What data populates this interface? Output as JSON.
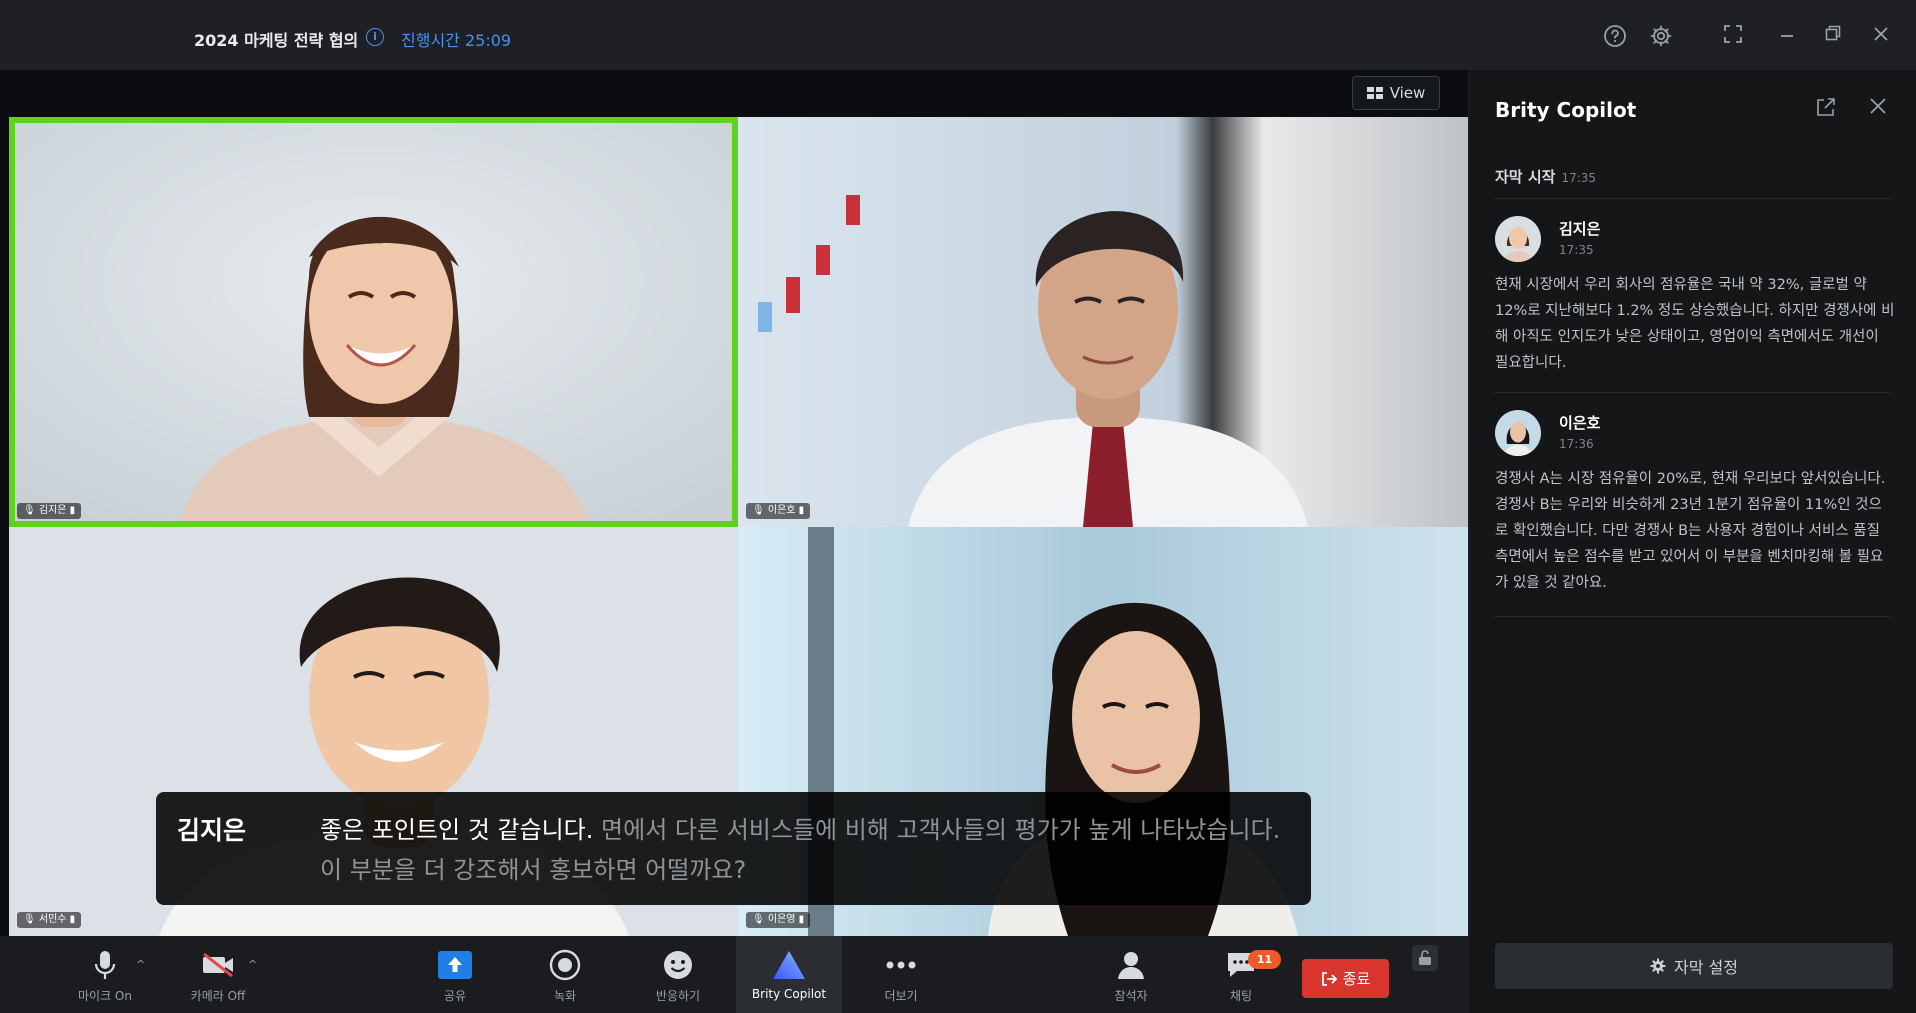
{
  "header": {
    "meeting_title": "2024 마케팅 전략 협의",
    "info_glyph": "i",
    "elapsed_label": "진행시간 25:09",
    "icons": [
      "help-icon",
      "settings-icon",
      "fullscreen-icon",
      "minimize-icon",
      "restore-icon",
      "close-icon"
    ]
  },
  "stage": {
    "view_label": "View",
    "participants": [
      {
        "tag": "김지은",
        "active": true
      },
      {
        "tag": "이은호",
        "active": false
      },
      {
        "tag": "서민수",
        "active": false
      },
      {
        "tag": "이은영",
        "active": false
      }
    ]
  },
  "caption": {
    "speaker": "김지은",
    "spoken": "좋은 포인트인 것 같습니다.",
    "previous": " 면에서 다른 서비스들에 비해 고객사들의 평가가 높게 나타났습니다. 이 부분을 더 강조해서 홍보하면 어떨까요?"
  },
  "toolbar": {
    "mic_label": "마이크 On",
    "camera_label": "카메라 Off",
    "share_label": "공유",
    "record_label": "녹화",
    "reaction_label": "반응하기",
    "copilot_label": "Brity Copilot",
    "more_label": "더보기",
    "participants_label": "참석자",
    "chat_label": "채팅",
    "chat_badge": "11",
    "end_label": "종료"
  },
  "panel": {
    "title": "Brity Copilot",
    "subtitle_start_label": "자막 시작",
    "subtitle_start_time": "17:35",
    "messages": [
      {
        "name": "김지은",
        "time": "17:35",
        "text": "현재 시장에서 우리 회사의 점유율은 국내 약 32%, 글로벌 약 12%로 지난해보다 1.2% 정도 상승했습니다. 하지만 경쟁사에 비해 아직도 인지도가 낮은 상태이고, 영업이익 측면에서도 개선이 필요합니다."
      },
      {
        "name": "이은호",
        "time": "17:36",
        "text": "경쟁사 A는 시장 점유율이 20%로, 현재 우리보다 앞서있습니다. 경쟁사 B는 우리와 비슷하게 23년 1분기 점유율이 11%인 것으로 확인했습니다. 다만 경쟁사 B는 사용자 경험이나 서비스 품질 측면에서 높은 점수를 받고 있어서 이 부분을 벤치마킹해 볼 필요가 있을 것 같아요."
      }
    ],
    "settings_label": "자막 설정"
  },
  "colors": {
    "accent_blue": "#4a8ff2",
    "active_speaker": "#5ed21e",
    "end_red": "#d7352e",
    "badge_orange": "#f05a28"
  }
}
